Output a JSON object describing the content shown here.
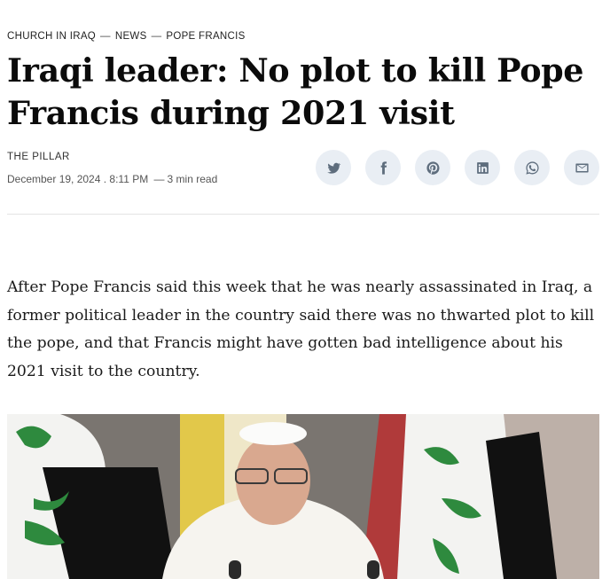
{
  "breadcrumb": {
    "items": [
      "CHURCH IN IRAQ",
      "NEWS",
      "POPE FRANCIS"
    ],
    "separator": "—"
  },
  "article": {
    "title": "Iraqi leader: No plot to kill Pope Francis during 2021 visit",
    "publication": "THE PILLAR",
    "date": "December 19, 2024 . 8:11 PM",
    "read_time": "3 min read",
    "lede": "After Pope Francis said this week that he was nearly assassinated in Iraq, a former political leader in the country said there was no thwarted plot to kill the pope, and that Francis might have gotten bad intelligence about his 2021 visit to the country."
  },
  "share": {
    "buttons": [
      {
        "icon": "twitter-icon"
      },
      {
        "icon": "facebook-icon"
      },
      {
        "icon": "pinterest-icon"
      },
      {
        "icon": "linkedin-icon"
      },
      {
        "icon": "whatsapp-icon"
      },
      {
        "icon": "email-icon"
      }
    ]
  },
  "colors": {
    "share_bg": "#e9eef4",
    "share_icon": "#5e6d7d",
    "divider": "#e3e3e3"
  }
}
